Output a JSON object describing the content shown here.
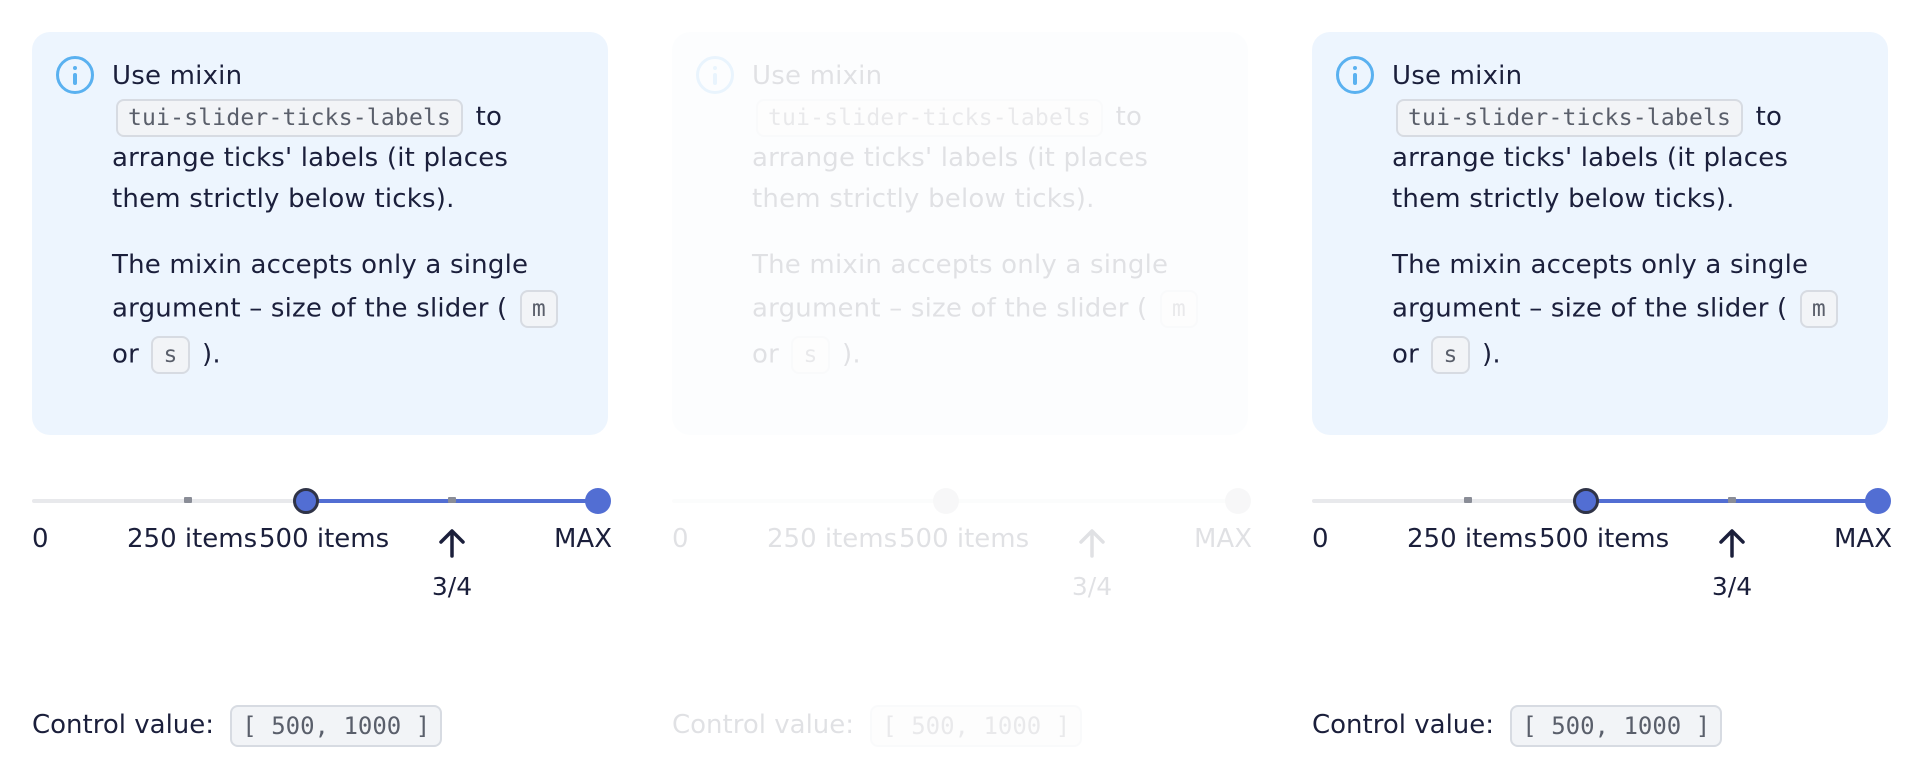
{
  "panels": [
    {
      "notification": {
        "line1": "Use mixin",
        "mixin_code": "tui-slider-ticks-labels",
        "after_code": "to arrange ticks' labels (it places them strictly below ticks).",
        "p2_before": "The mixin accepts only a single argument – size of the slider (",
        "size_m": "m",
        "p2_or": "or",
        "size_s": "s",
        "p2_end": ")."
      },
      "slider": {
        "labels": [
          "0",
          "250 items",
          "500 items",
          "MAX"
        ],
        "key_step_label": "3/4",
        "range_value_start_fraction": 0.5,
        "range_value_end_fraction": 1.0,
        "tick_fractions": [
          0.25,
          0.75
        ]
      },
      "control": {
        "label": "Control value:",
        "value": "[ 500, 1000 ]"
      }
    },
    {
      "notification": {
        "line1": "Use mixin",
        "mixin_code": "tui-slider-ticks-labels",
        "after_code": "to arrange ticks' labels (it places them strictly below ticks).",
        "p2_before": "The mixin accepts only a single argument – size of the slider (",
        "size_m": "m",
        "p2_or": "or",
        "size_s": "s",
        "p2_end": ")."
      },
      "slider": {
        "labels": [
          "0",
          "250 items",
          "500 items",
          "MAX"
        ],
        "key_step_label": "3/4"
      },
      "control": {
        "label": "Control value:",
        "value": "[ 500, 1000 ]"
      }
    },
    {
      "notification": {
        "line1": "Use mixin",
        "mixin_code": "tui-slider-ticks-labels",
        "after_code": "to arrange ticks' labels (it places them strictly below ticks).",
        "p2_before": "The mixin accepts only a single argument – size of the slider (",
        "size_m": "m",
        "p2_or": "or",
        "size_s": "s",
        "p2_end": ")."
      },
      "slider": {
        "labels": [
          "0",
          "250 items",
          "500 items",
          "MAX"
        ],
        "key_step_label": "3/4"
      },
      "control": {
        "label": "Control value:",
        "value": "[ 500, 1000 ]"
      }
    }
  ],
  "icons": {
    "info": "info-icon",
    "arrow": "arrow-up-icon"
  },
  "colors": {
    "accent": "#526ed3",
    "notification_bg": "#edf5fe",
    "info_icon": "#5ab1f0"
  }
}
